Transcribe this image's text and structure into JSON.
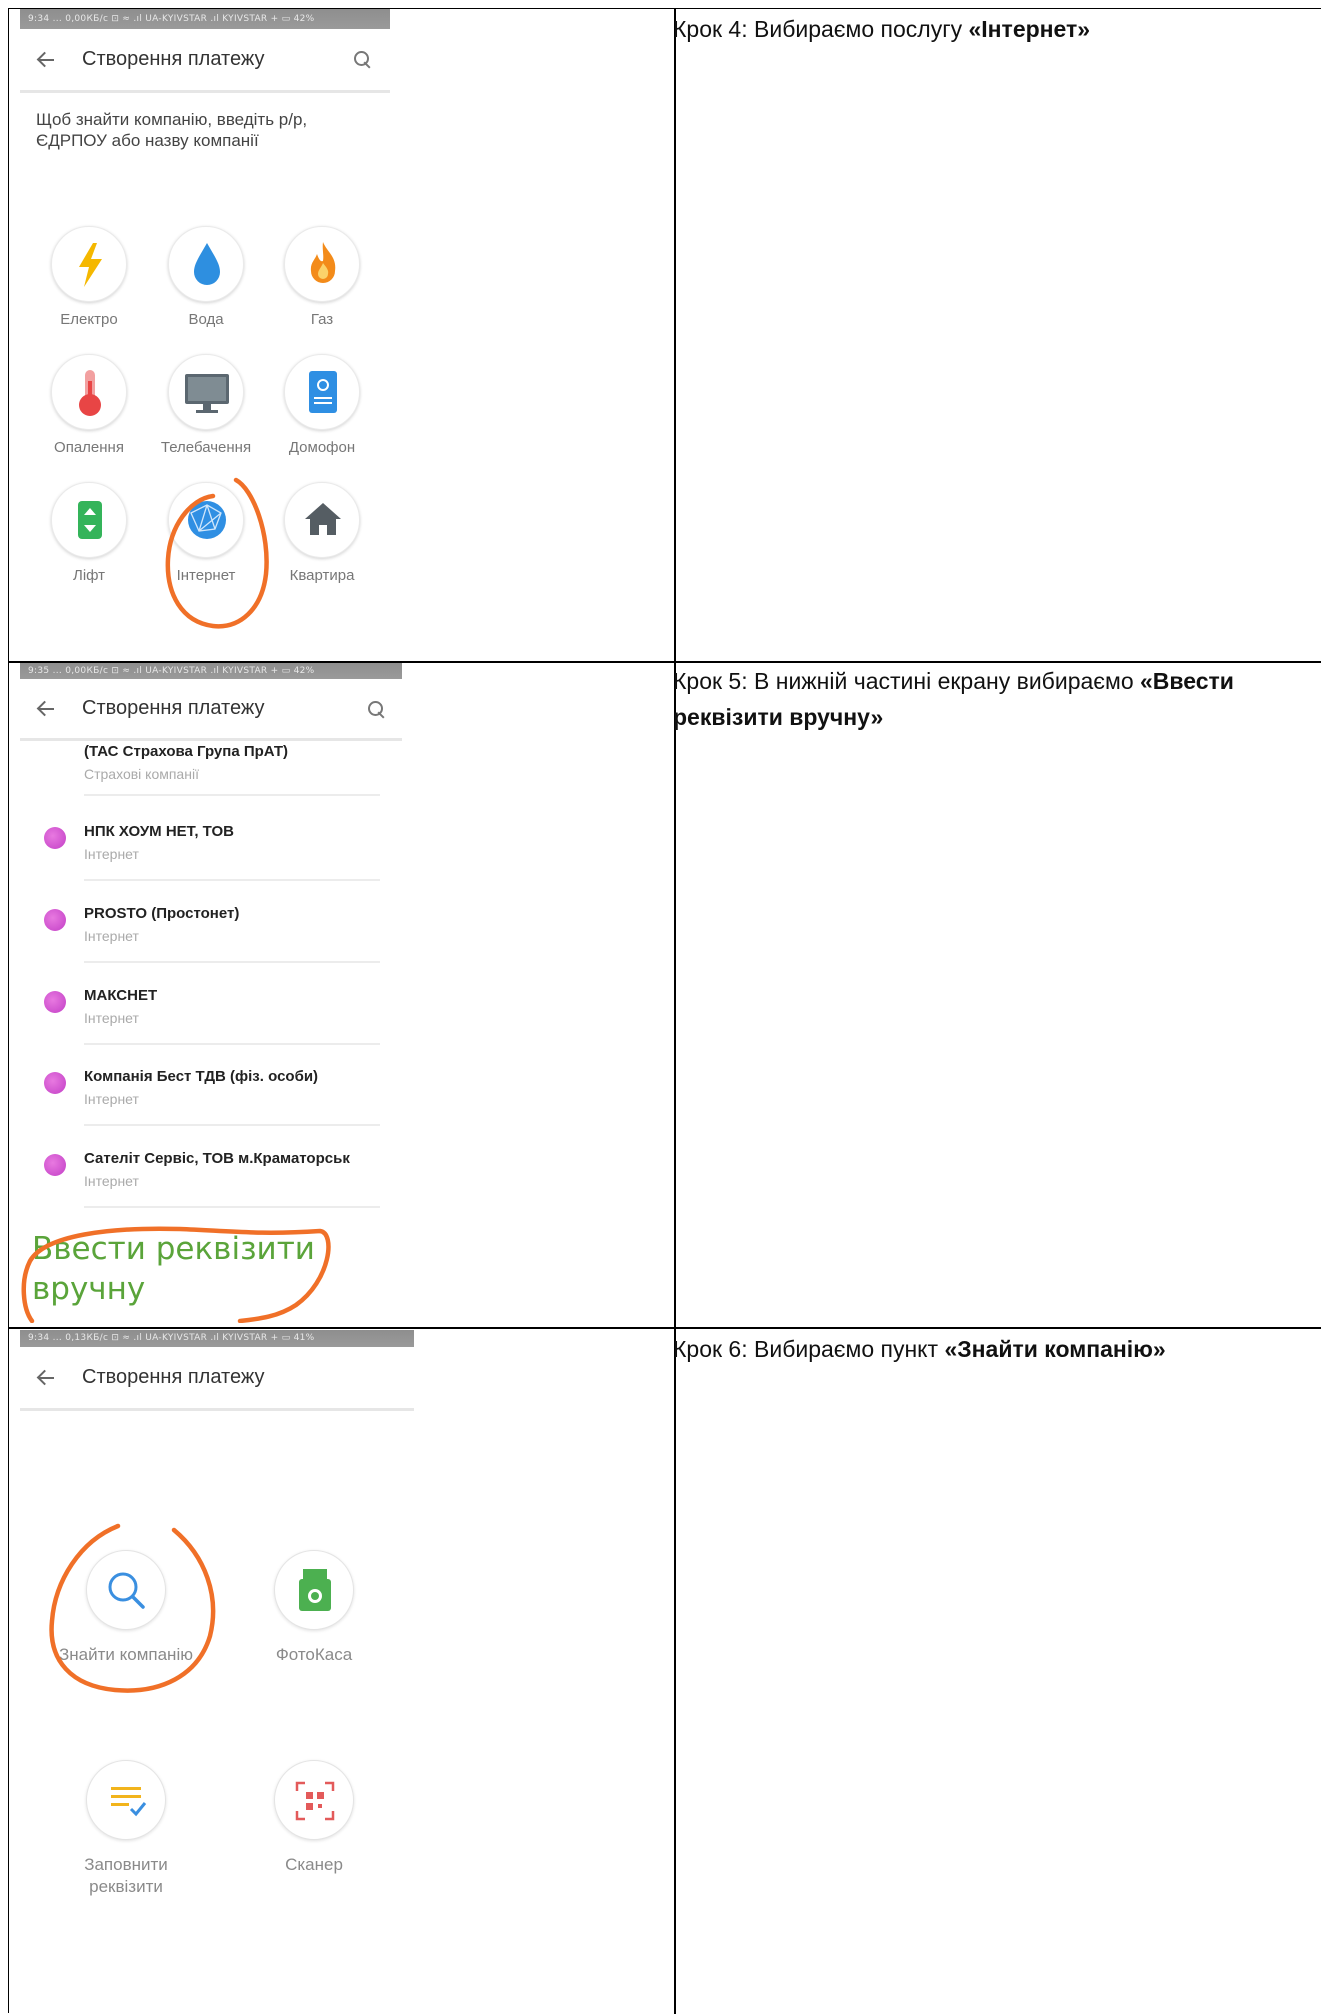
{
  "colors": {
    "annotation": "#f07028",
    "accent_green": "#5aa43a",
    "internet_dot": "#c23fc6"
  },
  "steps": [
    {
      "prefix": "Крок 4: Вибираємо послугу ",
      "bold": "«Інтернет»",
      "suffix": ""
    },
    {
      "prefix": "Крок 5: В нижній частині екрану вибираємо ",
      "bold": "«Ввести реквізити вручну»",
      "suffix": ""
    },
    {
      "prefix": "Крок 6:  Вибираємо пункт ",
      "bold": "«Знайти компанію»",
      "suffix": ""
    }
  ],
  "screen1": {
    "status": "9:34 ... 0,00КБ/с  ⊡  ≈  .ıl UA-KYIVSTAR   .ıl KYIVSTAR  +  ▭  42%",
    "title": "Створення платежу",
    "hint": "Щоб знайти компанію, введіть р/р, ЄДРПОУ або назву компанії",
    "categories": [
      {
        "label": "Електро",
        "icon": "lightning-icon"
      },
      {
        "label": "Вода",
        "icon": "water-drop-icon"
      },
      {
        "label": "Газ",
        "icon": "flame-icon"
      },
      {
        "label": "Опалення",
        "icon": "thermometer-icon"
      },
      {
        "label": "Телебачення",
        "icon": "tv-icon"
      },
      {
        "label": "Домофон",
        "icon": "intercom-icon"
      },
      {
        "label": "Ліфт",
        "icon": "elevator-icon"
      },
      {
        "label": "Інтернет",
        "icon": "globe-icon"
      },
      {
        "label": "Квартира",
        "icon": "house-icon"
      }
    ]
  },
  "screen2": {
    "status": "9:35 ... 0,00КБ/с  ⊡  ≈  .ıl UA-KYIVSTAR   .ıl KYIVSTAR  +  ▭  42%",
    "title": "Створення платежу",
    "first_row": {
      "name": "(ТАС Страхова Група ПрАТ)",
      "sub": "Страхові компанії"
    },
    "companies": [
      {
        "name": "НПК ХОУМ НЕТ, ТОВ",
        "sub": "Інтернет"
      },
      {
        "name": "PROSTO (Простонет)",
        "sub": "Інтернет"
      },
      {
        "name": "МАКСНЕТ",
        "sub": "Інтернет"
      },
      {
        "name": "Компанія Бест ТДВ (фіз. особи)",
        "sub": "Інтернет"
      },
      {
        "name": "Сателіт Сервіс, ТОВ м.Краматорськ",
        "sub": "Інтернет"
      }
    ],
    "manual_line1": "Ввести реквізити",
    "manual_line2": "вручну"
  },
  "screen3": {
    "status": "9:34 ... 0,13КБ/с  ⊡  ≈  .ıl UA-KYIVSTAR   .ıl KYIVSTAR  +  ▭  41%",
    "title": "Створення платежу",
    "options": [
      {
        "label": "Знайти компанію",
        "icon": "magnifier-icon"
      },
      {
        "label": "ФотоКаса",
        "icon": "photo-cash-icon"
      },
      {
        "label": "Заповнити реквізити",
        "icon": "fill-form-icon"
      },
      {
        "label": "Сканер",
        "icon": "qr-scanner-icon"
      }
    ]
  }
}
